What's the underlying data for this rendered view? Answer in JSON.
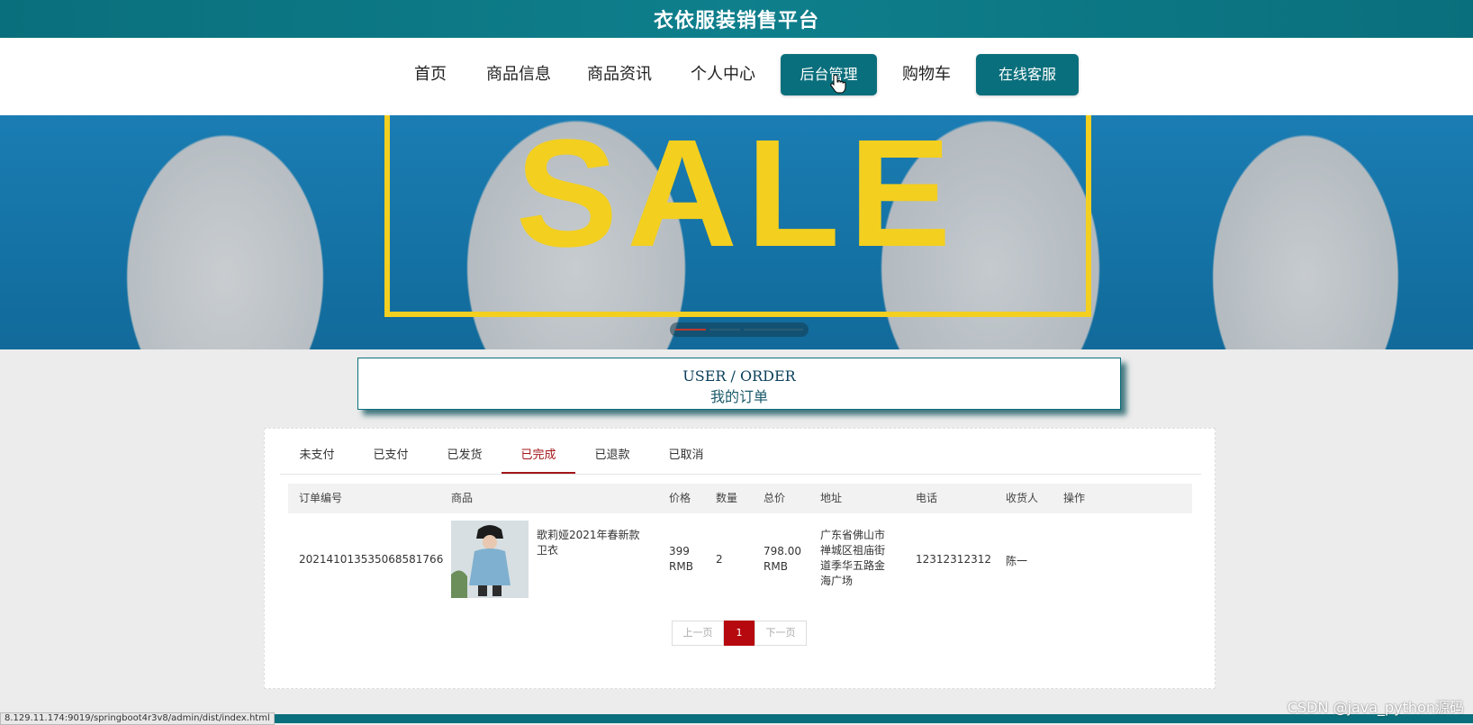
{
  "site": {
    "title": "衣依服装销售平台"
  },
  "nav": {
    "items": [
      {
        "label": "首页"
      },
      {
        "label": "商品信息"
      },
      {
        "label": "商品资讯"
      },
      {
        "label": "个人中心"
      },
      {
        "label": "后台管理"
      },
      {
        "label": "购物车"
      },
      {
        "label": "在线客服"
      }
    ]
  },
  "banner": {
    "text": "SALE"
  },
  "section": {
    "title_en": "USER / ORDER",
    "title_cn": "我的订单"
  },
  "tabs": [
    {
      "label": "未支付"
    },
    {
      "label": "已支付"
    },
    {
      "label": "已发货"
    },
    {
      "label": "已完成",
      "active": true
    },
    {
      "label": "已退款"
    },
    {
      "label": "已取消"
    }
  ],
  "table": {
    "headers": [
      "订单编号",
      "商品",
      "价格",
      "数量",
      "总价",
      "地址",
      "电话",
      "收货人",
      "操作"
    ],
    "rows": [
      {
        "order_no": "202141013535068581766",
        "product": "歌莉娅2021年春新款卫衣",
        "price": "399 RMB",
        "qty": "2",
        "total": "798.00 RMB",
        "address": "广东省佛山市禅城区祖庙街道季华五路金海广场",
        "phone": "12312312312",
        "receiver": "陈一"
      }
    ]
  },
  "pager": {
    "prev": "上一页",
    "current": "1",
    "next": "下一页"
  },
  "status_url": "8.129.11.174:9019/springboot4r3v8/admin/dist/index.html",
  "watermark": "CSDN @java_python源码",
  "colors": {
    "primary": "#0a6f7c",
    "accent": "#a3161a",
    "sale": "#f3cf1f"
  }
}
